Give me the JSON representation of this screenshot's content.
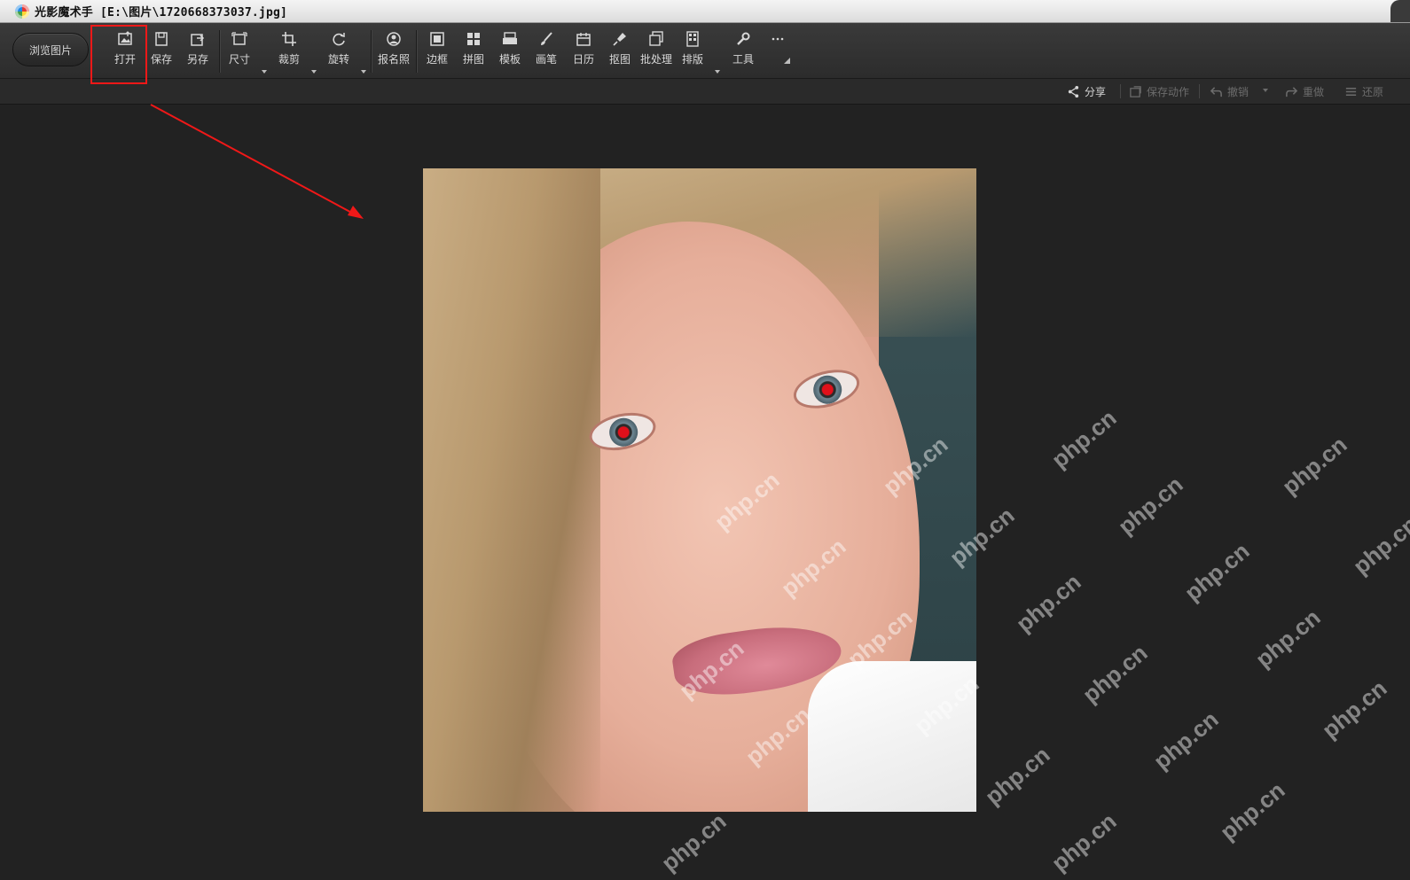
{
  "window": {
    "title": "光影魔术手 [E:\\图片\\1720668373037.jpg]"
  },
  "toolbar": {
    "browse_label": "浏览图片",
    "tools": [
      {
        "label": "打开",
        "icon": "open-image-icon"
      },
      {
        "label": "保存",
        "icon": "save-icon"
      },
      {
        "label": "另存",
        "icon": "save-as-icon"
      },
      {
        "label": "尺寸",
        "icon": "resize-icon"
      },
      {
        "label": "裁剪",
        "icon": "crop-icon"
      },
      {
        "label": "旋转",
        "icon": "rotate-icon"
      },
      {
        "label": "报名照",
        "icon": "id-photo-icon"
      },
      {
        "label": "边框",
        "icon": "frame-icon"
      },
      {
        "label": "拼图",
        "icon": "collage-icon"
      },
      {
        "label": "模板",
        "icon": "template-icon"
      },
      {
        "label": "画笔",
        "icon": "brush-icon"
      },
      {
        "label": "日历",
        "icon": "calendar-icon"
      },
      {
        "label": "抠图",
        "icon": "cutout-icon"
      },
      {
        "label": "批处理",
        "icon": "batch-icon"
      },
      {
        "label": "排版",
        "icon": "layout-icon"
      },
      {
        "label": "工具",
        "icon": "wrench-icon"
      },
      {
        "label": "",
        "icon": "more-icon"
      }
    ]
  },
  "subbar": {
    "share": "分享",
    "save_action": "保存动作",
    "undo": "撤销",
    "redo": "重做",
    "restore": "还原"
  },
  "canvas": {
    "watermark": "php.cn"
  },
  "colors": {
    "highlight": "#f01818",
    "canvas_bg": "#222222",
    "toolbar_bg": "#333333"
  }
}
